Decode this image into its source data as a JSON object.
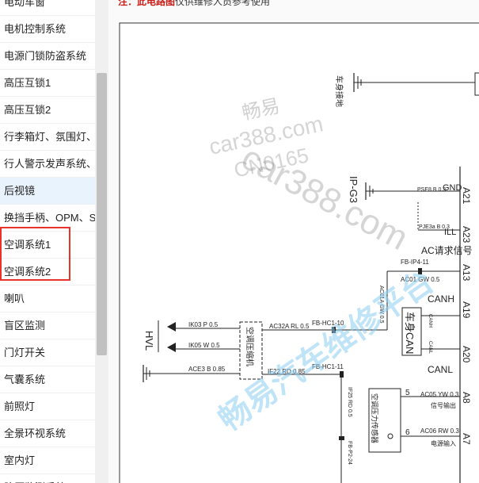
{
  "sidebar": {
    "items": [
      {
        "label": "电动车窗"
      },
      {
        "label": "电机控制系统"
      },
      {
        "label": "电源门锁防盗系统"
      },
      {
        "label": "高压互锁1"
      },
      {
        "label": "高压互锁2"
      },
      {
        "label": "行李箱灯、氛围灯、"
      },
      {
        "label": "行人警示发声系统、"
      },
      {
        "label": "后视镜"
      },
      {
        "label": "换挡手柄、OPM、S"
      },
      {
        "label": "空调系统1"
      },
      {
        "label": "空调系统2"
      },
      {
        "label": "喇叭"
      },
      {
        "label": "盲区监测"
      },
      {
        "label": "门灯开关"
      },
      {
        "label": "气囊系统"
      },
      {
        "label": "前照灯"
      },
      {
        "label": "全景环视系统"
      },
      {
        "label": "室内灯"
      },
      {
        "label": "胎压监测系统"
      }
    ]
  },
  "document": {
    "header_red": "注：此电路图",
    "header_rest": "仅供维修人员参考使用"
  },
  "diagram": {
    "ground_label": "车身接地",
    "ip_g3": "IP-G3",
    "wire_gnd": "PSE8 B 0.3",
    "pin_gnd": "GND",
    "pin_a21": "A21",
    "wire_ill": "PJE3a B 0.3",
    "pin_ill": "ILL",
    "pin_a23": "A23",
    "ac_signal": "AC请求信号",
    "fb_ip4": "FB-IP4-11",
    "wire_ac01": "AC01 GW 0.5",
    "pin_a13": "A13",
    "wire_ac01a": "AC01A GW 0.5",
    "canh": "CANH",
    "pin_a19": "A19",
    "can_bus": "车身CAN",
    "can_h_small": "CANH",
    "can_l_small": "CANL",
    "pin_a20": "A20",
    "canl": "CANL",
    "hvl": "HVL",
    "wire_ik03": "IK03 P 0.5",
    "wire_ik05": "IK05 W 0.5",
    "wire_ace3": "ACE3 B 0.85",
    "compressor": "空调压缩机",
    "wire_ac32a": "AC32A RL 0.5",
    "fb_hc1_10": "FB-HC1-10",
    "wire_if22": "IF22 RD 0.85",
    "fb_hc1_11": "FB-HC1-11",
    "wire_if25": "IF25 RD 0.5",
    "fb_p2_24": "FB-P2-24",
    "sensor": "空调压力传感器",
    "pin5": "5",
    "pin6": "6",
    "wire_ac05": "AC05 YW 0.3",
    "wire_ac06": "AC06 RW 0.3",
    "sig_out": "信号输出",
    "sig_in": "电源输入",
    "pin_a8": "A8",
    "pin_a7": "A7"
  },
  "watermarks": {
    "w1": "畅易",
    "w2": "car388.com",
    "w3": "CN0165",
    "w4": "car388.com",
    "w5": "畅易汽车维修平台"
  }
}
